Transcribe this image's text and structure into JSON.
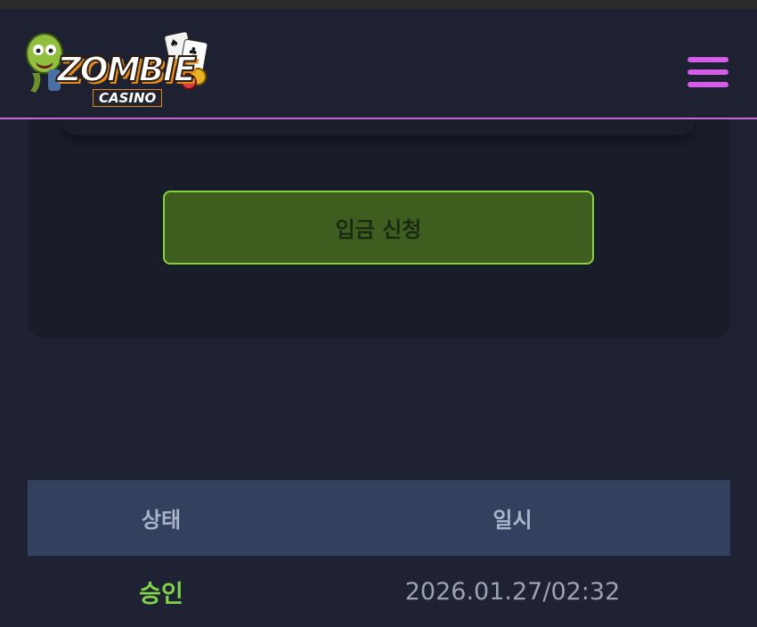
{
  "header": {
    "logo": {
      "primary_text": "ZOMBIE",
      "secondary_text": "CASINO"
    },
    "menu_icon": "hamburger-icon"
  },
  "deposit": {
    "button_label": "입금 신청"
  },
  "history": {
    "columns": [
      "상태",
      "일시"
    ],
    "rows": [
      {
        "status": "승인",
        "datetime": "2026.01.27/02:32"
      }
    ]
  },
  "colors": {
    "accent_pink": "#c86bd8",
    "button_green": "#3d5e1f",
    "button_border": "#86d33b",
    "status_green": "#7ed348"
  }
}
